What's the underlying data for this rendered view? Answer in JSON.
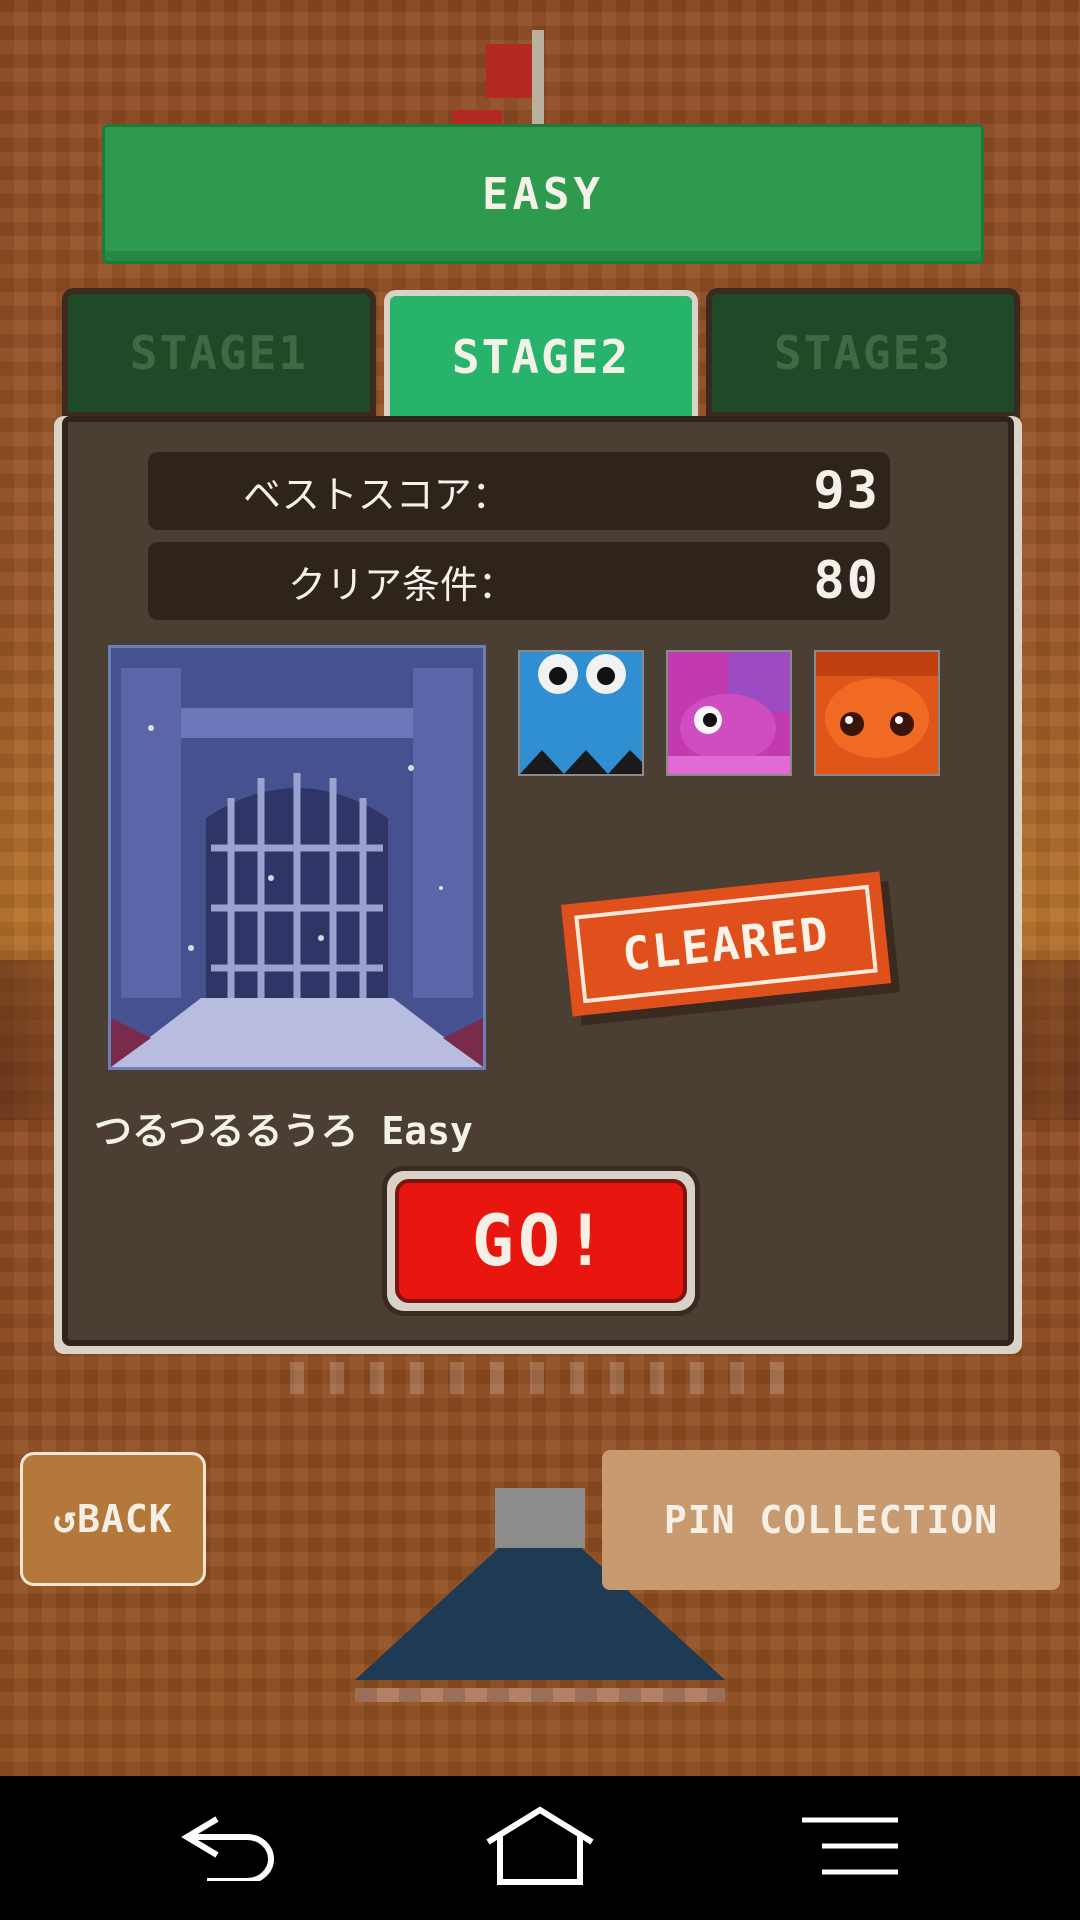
{
  "difficulty": {
    "label": "EASY"
  },
  "tabs": [
    {
      "label": "STAGE1",
      "active": false
    },
    {
      "label": "STAGE2",
      "active": true
    },
    {
      "label": "STAGE3",
      "active": false
    }
  ],
  "stats": {
    "best_score_label": "ベストスコア：",
    "best_score_value": "93",
    "clear_condition_label": "クリア条件：",
    "clear_condition_value": "80"
  },
  "stage": {
    "name": "つるつるるうろ Easy",
    "status": "CLEARED",
    "characters": [
      "blue-monster-icon",
      "purple-fish-icon",
      "orange-octopus-icon"
    ]
  },
  "actions": {
    "go_label": "GO!",
    "back_label": "↺BACK",
    "pin_collection_label": "PIN COLLECTION"
  },
  "colors": {
    "difficulty_green": "#2d9a4e",
    "active_tab": "#27b36a",
    "panel": "#4b3e33",
    "go_red": "#e8160e",
    "cleared_orange": "#e0501c"
  }
}
